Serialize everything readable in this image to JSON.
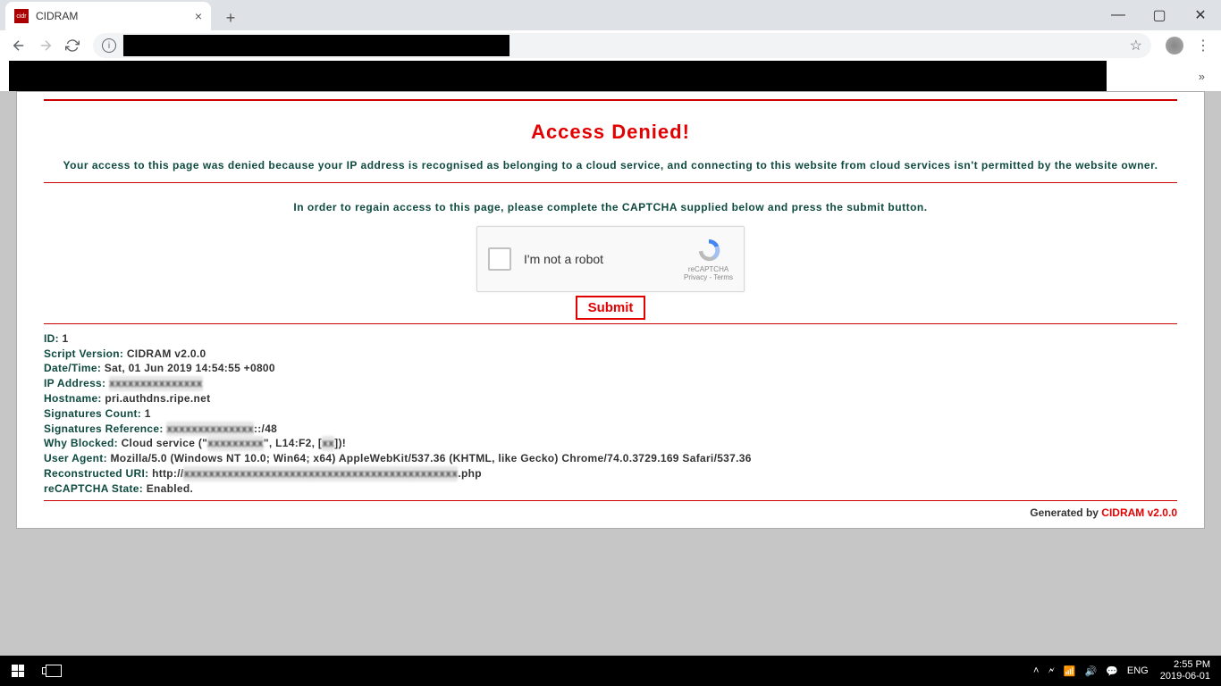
{
  "browser": {
    "tab_title": "CIDRAM",
    "favicon_text": "cidr\nam"
  },
  "page": {
    "title": "Access Denied!",
    "reason": "Your access to this page was denied because your IP address is recognised as belonging to a cloud service, and connecting to this website from cloud services isn't permitted by the website owner.",
    "instruction": "In order to regain access to this page, please complete the CAPTCHA supplied below and press the submit button."
  },
  "captcha": {
    "label": "I'm not a robot",
    "brand": "reCAPTCHA",
    "legal": "Privacy - Terms",
    "submit": "Submit"
  },
  "details": {
    "id_k": "ID:",
    "id_v": "1",
    "script_k": "Script Version:",
    "script_v": "CIDRAM v2.0.0",
    "date_k": "Date/Time:",
    "date_v": "Sat, 01 Jun 2019 14:54:55 +0800",
    "ip_k": "IP Address:",
    "host_k": "Hostname:",
    "host_v": "pri.authdns.ripe.net",
    "sigcount_k": "Signatures Count:",
    "sigcount_v": "1",
    "sigref_k": "Signatures Reference:",
    "sigref_suffix": "::/48",
    "why_k": "Why Blocked:",
    "why_pre": "Cloud service (\"",
    "why_mid": "\", L14:F2, [",
    "why_post": "])!",
    "ua_k": "User Agent:",
    "ua_v": "Mozilla/5.0 (Windows NT 10.0; Win64; x64) AppleWebKit/537.36 (KHTML, like Gecko) Chrome/74.0.3729.169 Safari/537.36",
    "uri_k": "Reconstructed URI:",
    "uri_pre": "http://",
    "uri_suffix": ".php",
    "rec_k": "reCAPTCHA State:",
    "rec_v": "Enabled."
  },
  "footer": {
    "text": "Generated by ",
    "link": "CIDRAM v2.0.0"
  },
  "taskbar": {
    "lang": "ENG",
    "time": "2:55 PM",
    "date": "2019-06-01"
  }
}
